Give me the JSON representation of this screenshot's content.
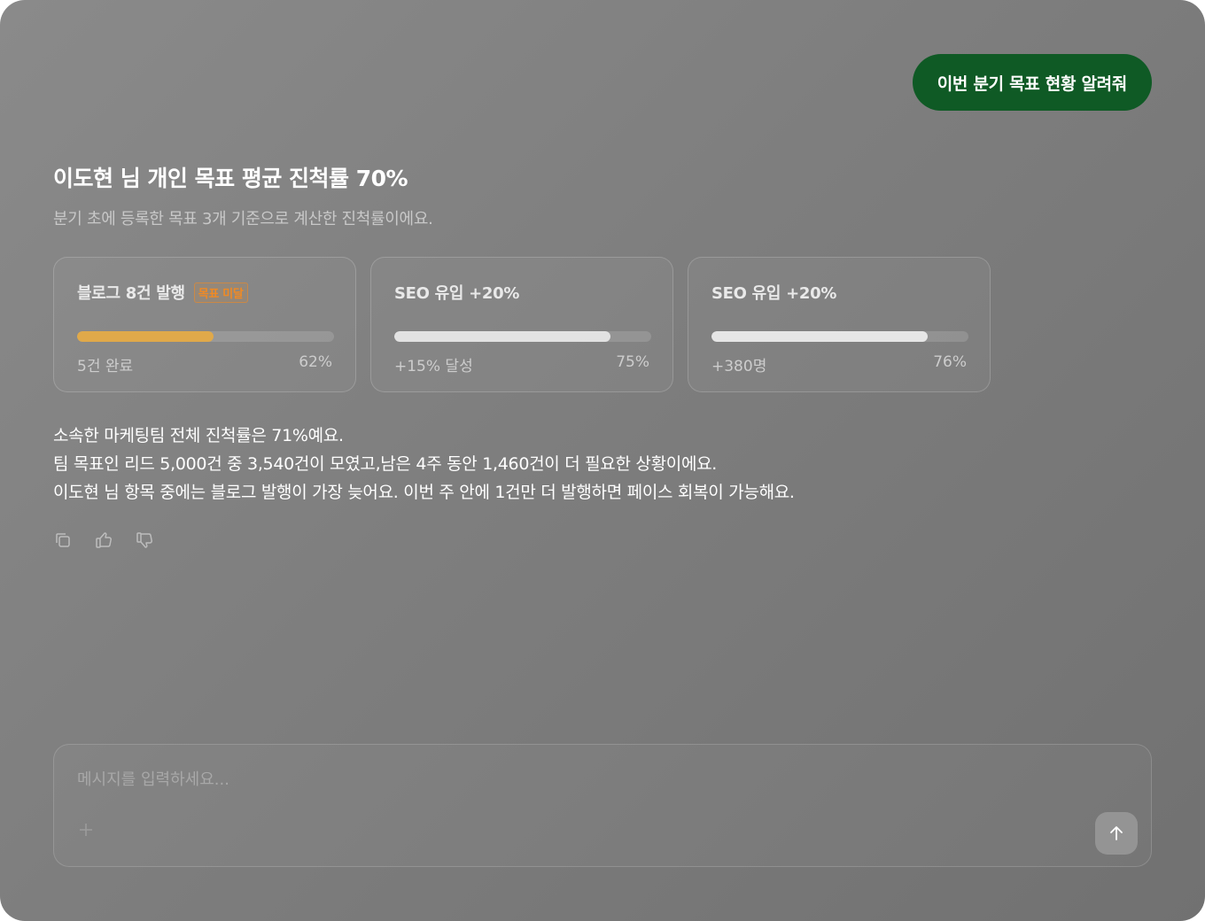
{
  "user_message": "이번 분기 목표 현황 알려줘",
  "response": {
    "headline": "이도현 님 개인 목표 평균 진척률 70%",
    "subline": "분기 초에 등록한 목표 3개 기준으로 계산한 진척률이에요.",
    "cards": [
      {
        "title": "블로그 8건 발행",
        "badge": "목표 미달",
        "progress": 0.53,
        "bar_color": "#e0a94a",
        "left": "5건 완료",
        "right": "62%"
      },
      {
        "title": "SEO 유입 +20%",
        "badge": "",
        "progress": 0.84,
        "bar_color": "#e2e2e2",
        "left": "+15% 달성",
        "right": "75%"
      },
      {
        "title": "SEO 유입 +20%",
        "badge": "",
        "progress": 0.84,
        "bar_color": "#e6e6e6",
        "left": "+380명",
        "right": "76%"
      }
    ],
    "body_lines": [
      "소속한 마케팅팀 전체 진척률은 71%예요.",
      "팀 목표인 리드 5,000건 중 3,540건이 모였고,남은 4주 동안 1,460건이 더 필요한 상황이에요.",
      "이도현 님 항목 중에는 블로그 발행이 가장 늦어요. 이번 주 안에 1건만 더 발행하면 페이스 회복이 가능해요."
    ],
    "actions": [
      "copy-icon",
      "thumbs-up-icon",
      "thumbs-down-icon"
    ]
  },
  "composer": {
    "placeholder": "메시지를 입력하세요...",
    "value": "",
    "plus_icon": "plus-icon",
    "send_icon": "arrow-up-icon"
  }
}
